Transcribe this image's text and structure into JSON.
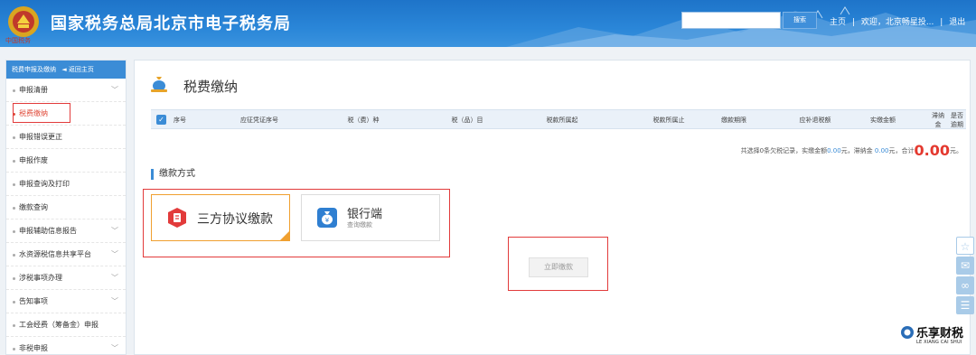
{
  "header": {
    "logo_sub": "中国税务",
    "title": "国家税务总局北京市电子税务局",
    "search_placeholder": "",
    "search_button": "搜索",
    "home_link": "主页",
    "welcome": "欢迎，北京畅星投...",
    "logout": "退出",
    "sep": "|"
  },
  "sidebar": {
    "head_label": "税费申报及缴纳",
    "back_label": "返回主页",
    "back_icon": "arrow-left-icon",
    "items": [
      {
        "label": "申报清册",
        "has_chevron": true,
        "active": false
      },
      {
        "label": "税费缴纳",
        "has_chevron": false,
        "active": true
      },
      {
        "label": "申报错误更正",
        "has_chevron": false,
        "active": false
      },
      {
        "label": "申报作废",
        "has_chevron": false,
        "active": false
      },
      {
        "label": "申报查询及打印",
        "has_chevron": false,
        "active": false
      },
      {
        "label": "缴款查询",
        "has_chevron": false,
        "active": false
      },
      {
        "label": "申报辅助信息报告",
        "has_chevron": true,
        "active": false
      },
      {
        "label": "水资源税信息共享平台",
        "has_chevron": true,
        "active": false
      },
      {
        "label": "涉税事项办理",
        "has_chevron": true,
        "active": false
      },
      {
        "label": "告知事项",
        "has_chevron": true,
        "active": false
      },
      {
        "label": "工会经费（筹备金）申报",
        "has_chevron": false,
        "active": false
      },
      {
        "label": "非税申报",
        "has_chevron": true,
        "active": false
      }
    ],
    "chevron": "﹀"
  },
  "main": {
    "page_title": "税费缴纳",
    "page_icon": "money-bag-icon",
    "table_headers": [
      {
        "label": "序号"
      },
      {
        "label": "应征凭证序号"
      },
      {
        "label": "税（费）种"
      },
      {
        "label": "税（品）目"
      },
      {
        "label": "税款所属起"
      },
      {
        "label": "税款所属止"
      },
      {
        "label": "缴款期限"
      },
      {
        "label": "应补退税额"
      },
      {
        "label": "实缴金额"
      },
      {
        "label": "滞纳金",
        "line1": "滞纳",
        "line2": "金"
      },
      {
        "label": "是否逾期",
        "line1": "是否",
        "line2": "逾期"
      }
    ],
    "summary": {
      "prefix": "共选择0条欠税记录，实缴金额",
      "amount": "0.00",
      "mid1": "元，滞纳金",
      "late_fee": "0.00",
      "mid2": "元，合计",
      "total": "0.00",
      "suffix": "元。"
    },
    "section_title": "缴款方式",
    "methods": [
      {
        "label": "三方协议缴款",
        "icon": "tripartite-agreement-icon",
        "selected": true
      },
      {
        "label": "银行端",
        "sub": "查询缴款",
        "icon": "bank-money-bag-icon",
        "selected": false
      }
    ],
    "pay_now": "立即缴款"
  },
  "floating": [
    {
      "icon": "star-icon",
      "color": "#a9cbe8"
    },
    {
      "icon": "chat-icon",
      "color": "#a9cbe8"
    },
    {
      "icon": "link-icon",
      "color": "#a9cbe8"
    },
    {
      "icon": "feedback-icon",
      "color": "#a9cbe8"
    }
  ],
  "watermark": {
    "cn": "乐享财税",
    "en": "LE XIANG CAI SHUI"
  },
  "colors": {
    "accent": "#3b8cd6",
    "header": "#2a86d8",
    "highlight": "#e23b3b",
    "amount": "#e4392f",
    "selected_card": "#f0a030"
  }
}
